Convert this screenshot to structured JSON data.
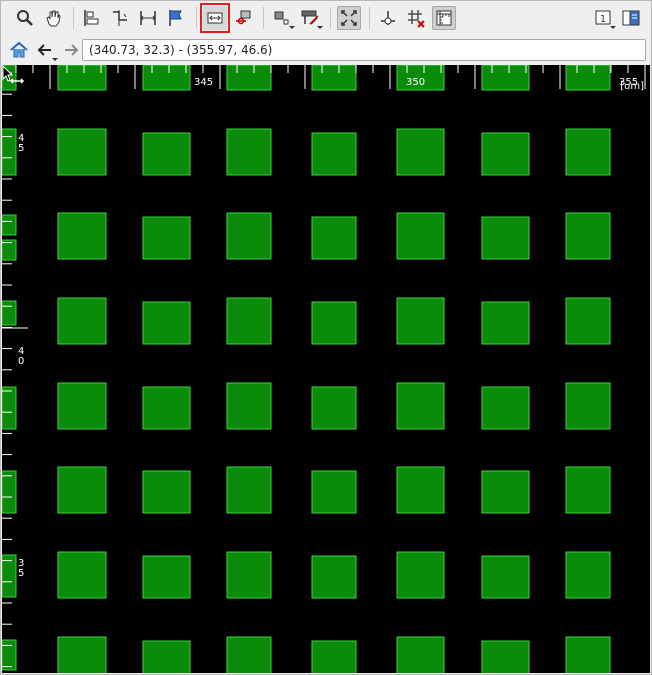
{
  "window": {
    "coordinate_readout": "(340.73, 32.3) - (355.97, 46.6)"
  },
  "toolbar": {
    "tools": [
      {
        "icon": "zoom-icon"
      },
      {
        "icon": "pan-hand-icon"
      },
      {
        "icon": "align-left-icon"
      },
      {
        "icon": "align-step-icon"
      },
      {
        "icon": "align-horizontal-icon"
      },
      {
        "icon": "flag-icon"
      },
      {
        "icon": "measure-horizontal-icon",
        "active": true
      },
      {
        "icon": "snap-point-icon"
      },
      {
        "icon": "layer-select-icon",
        "dropdown": true
      },
      {
        "icon": "text-tool-icon",
        "dropdown": true
      },
      {
        "icon": "fit-view-icon",
        "pressed": true
      },
      {
        "icon": "origin-icon"
      },
      {
        "icon": "grid-off-icon"
      },
      {
        "icon": "ruler-icon",
        "pressed": true
      },
      {
        "icon": "page-one-icon",
        "label": "1",
        "dropdown": true
      },
      {
        "icon": "split-panel-icon"
      }
    ]
  },
  "nav": {
    "home_icon": "home-icon",
    "back_icon": "back-arrow-icon",
    "forward_icon": "forward-arrow-icon"
  },
  "ruler": {
    "x_labels": [
      "345",
      "350",
      "355"
    ],
    "y_labels": [
      "4\n5",
      "4\n0",
      "3\n5"
    ],
    "unit": "[um]"
  },
  "colors": {
    "square_fill": "#0a8c0a",
    "square_stroke": "#3ecf3e",
    "background": "#000000",
    "highlight": "#e02020"
  }
}
